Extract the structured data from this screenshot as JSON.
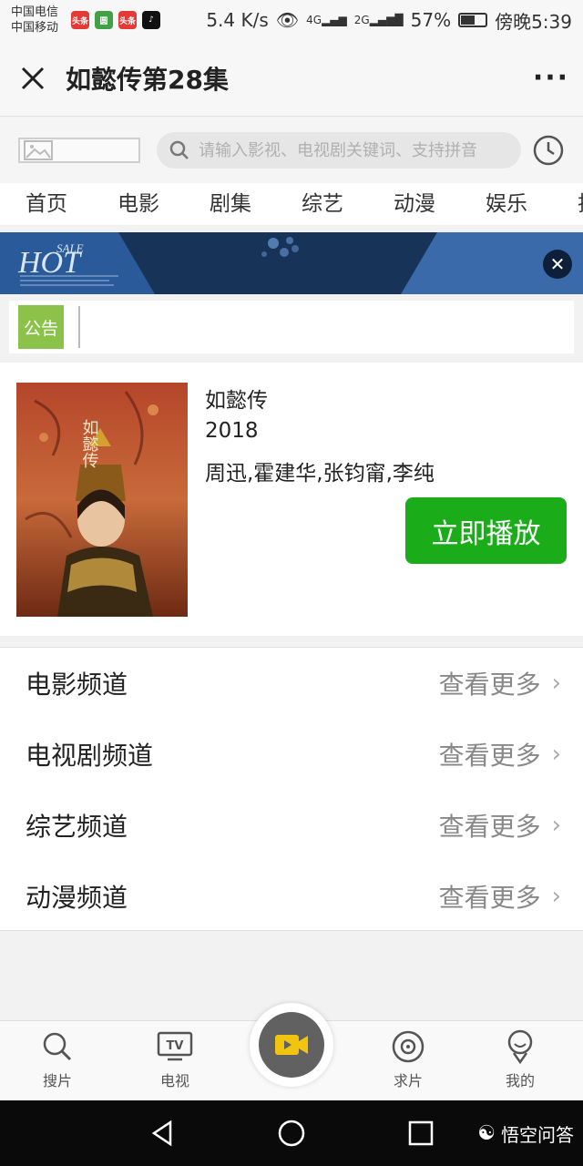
{
  "status_bar": {
    "carrier_1": "中国电信",
    "carrier_2": "中国移动",
    "speed": "5.4 K/s",
    "net_4g": "4G",
    "net_2g": "2G",
    "battery": "57%",
    "battery_level": 0.57,
    "time": "傍晚5:39",
    "badges": [
      "头条",
      "圆",
      "头条"
    ]
  },
  "title_bar": {
    "title": "如懿传第28集",
    "more": "···"
  },
  "search": {
    "placeholder": "请输入影视、电视剧关键词、支持拼音"
  },
  "nav_tabs": [
    "首页",
    "电影",
    "剧集",
    "综艺",
    "动漫",
    "娱乐",
    "排"
  ],
  "banner": {
    "line1": "SALE",
    "line2": "HOT"
  },
  "notice": {
    "badge": "公告"
  },
  "movie": {
    "poster_text": "如懿传",
    "title": "如懿传",
    "year": "2018",
    "cast": "周迅,霍建华,张钧甯,李纯",
    "play_label": "立即播放"
  },
  "channels": [
    {
      "name": "电影频道",
      "more": "查看更多"
    },
    {
      "name": "电视剧频道",
      "more": "查看更多"
    },
    {
      "name": "综艺频道",
      "more": "查看更多"
    },
    {
      "name": "动漫频道",
      "more": "查看更多"
    }
  ],
  "tab_bar": {
    "search": "搜片",
    "tv": "电视",
    "tv_icon_text": "TV",
    "request": "求片",
    "mine": "我的"
  },
  "watermark": "悟空问答",
  "colors": {
    "accent_green": "#1aad19",
    "notice_green": "#8bc34a",
    "banner_blue": "#1d3d6e"
  }
}
